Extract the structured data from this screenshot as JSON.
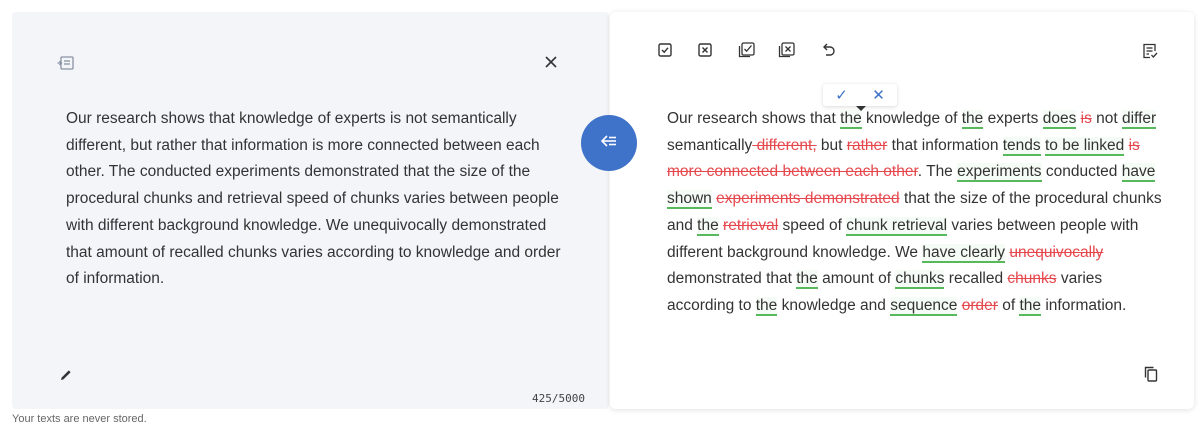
{
  "left": {
    "paragraph": "Our research shows that knowledge of experts is not semantically different, but rather that information is more connected between each other. The conducted experiments demonstrated that the size of the procedural chunks and retrieval speed of chunks varies between people with different background knowledge. We unequivocally demonstrated that amount of recalled chunks varies according to knowledge and order of information.",
    "counter": "425/5000"
  },
  "right": {
    "popover": {
      "accept": "✓",
      "reject": "✕"
    },
    "segments": [
      {
        "t": "Our research shows that ",
        "k": "n"
      },
      {
        "t": "the",
        "k": "i"
      },
      {
        "t": " knowledge of ",
        "k": "n"
      },
      {
        "t": "the",
        "k": "i"
      },
      {
        "t": " experts ",
        "k": "n"
      },
      {
        "t": "does",
        "k": "i"
      },
      {
        "t": " ",
        "k": "n"
      },
      {
        "t": "is",
        "k": "d"
      },
      {
        "t": " not ",
        "k": "n"
      },
      {
        "t": "differ",
        "k": "i"
      },
      {
        "t": " semantically",
        "k": "n"
      },
      {
        "t": " different,",
        "k": "d"
      },
      {
        "t": " but ",
        "k": "n"
      },
      {
        "t": "rather",
        "k": "d"
      },
      {
        "t": " that information ",
        "k": "n"
      },
      {
        "t": "tends",
        "k": "i"
      },
      {
        "t": " ",
        "k": "n"
      },
      {
        "t": " to be linked",
        "k": "i"
      },
      {
        "t": " ",
        "k": "n"
      },
      {
        "t": "is more connected between each other",
        "k": "d"
      },
      {
        "t": ". The ",
        "k": "n"
      },
      {
        "t": "experiments",
        "k": "i"
      },
      {
        "t": " conducted ",
        "k": "n"
      },
      {
        "t": "have shown",
        "k": "i"
      },
      {
        "t": " ",
        "k": "n"
      },
      {
        "t": "experiments demonstrated",
        "k": "d"
      },
      {
        "t": " that the size of the procedural chunks and ",
        "k": "n"
      },
      {
        "t": "the",
        "k": "i"
      },
      {
        "t": " ",
        "k": "n"
      },
      {
        "t": "retrieval",
        "k": "d"
      },
      {
        "t": " speed of ",
        "k": "n"
      },
      {
        "t": "chunk retrieval",
        "k": "i"
      },
      {
        "t": " varies between people with different background knowledge. We ",
        "k": "n"
      },
      {
        "t": "have clearly",
        "k": "i"
      },
      {
        "t": " ",
        "k": "n"
      },
      {
        "t": "unequivocally",
        "k": "d"
      },
      {
        "t": " demonstrated that ",
        "k": "n"
      },
      {
        "t": "the",
        "k": "i"
      },
      {
        "t": " amount of ",
        "k": "n"
      },
      {
        "t": "chunks",
        "k": "i"
      },
      {
        "t": " recalled ",
        "k": "n"
      },
      {
        "t": "chunks",
        "k": "d"
      },
      {
        "t": " varies according to ",
        "k": "n"
      },
      {
        "t": "the",
        "k": "i"
      },
      {
        "t": " knowledge and ",
        "k": "n"
      },
      {
        "t": "sequence",
        "k": "i"
      },
      {
        "t": " ",
        "k": "n"
      },
      {
        "t": "order",
        "k": "d"
      },
      {
        "t": " of ",
        "k": "n"
      },
      {
        "t": "the",
        "k": "i"
      },
      {
        "t": " information.",
        "k": "n"
      }
    ]
  },
  "footer": {
    "note": "Your texts are never stored."
  },
  "colors": {
    "accent": "#3f72c9",
    "insertion": "#58b85c",
    "deletion": "#e5484d",
    "left_panel_bg": "#f3f5f9"
  },
  "icons": {
    "left_panel_toggle": "panel-toggle-icon",
    "left_close": "close-icon",
    "left_edit": "pencil-icon",
    "transfer": "arrow-left-icon",
    "accept_all": "checkbox-check-icon",
    "reject_all": "checkbox-x-icon",
    "accept_all_list": "multi-check-icon",
    "reject_all_list": "multi-x-icon",
    "undo": "undo-icon",
    "compare": "document-check-icon",
    "copy": "copy-icon"
  }
}
